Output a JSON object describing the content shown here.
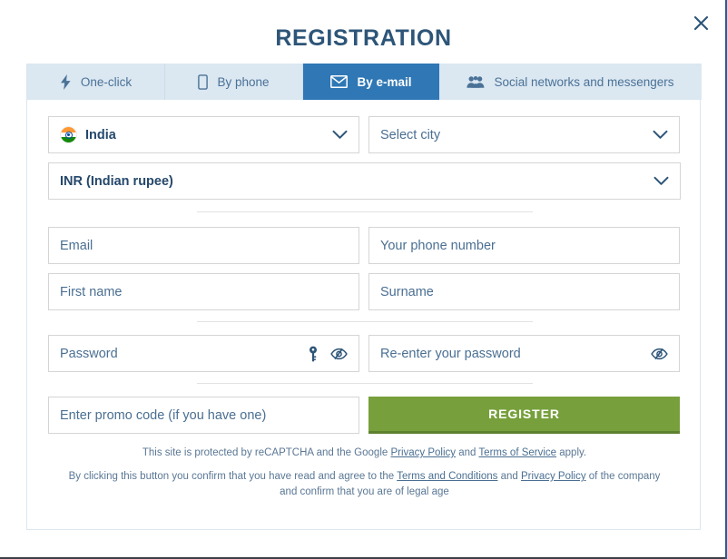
{
  "dialog": {
    "title": "REGISTRATION",
    "close_label": "×"
  },
  "tabs": [
    {
      "label": "One-click",
      "icon": "bolt-icon",
      "active": false
    },
    {
      "label": "By phone",
      "icon": "phone-icon",
      "active": false
    },
    {
      "label": "By e-mail",
      "icon": "envelope-icon",
      "active": true
    },
    {
      "label": "Social networks and messengers",
      "icon": "people-icon",
      "active": false
    }
  ],
  "form": {
    "country": {
      "value": "India",
      "icon": "india-flag-icon",
      "chevron": "chevron-down-icon"
    },
    "city": {
      "placeholder": "Select city",
      "chevron": "chevron-down-icon"
    },
    "currency": {
      "value": "INR (Indian rupee)",
      "chevron": "chevron-down-icon"
    },
    "email": {
      "placeholder": "Email",
      "value": ""
    },
    "phone": {
      "placeholder": "Your phone number",
      "value": ""
    },
    "first_name": {
      "placeholder": "First name",
      "value": ""
    },
    "surname": {
      "placeholder": "Surname",
      "value": ""
    },
    "password": {
      "placeholder": "Password",
      "value": "",
      "key_icon": "key-icon",
      "toggle_icon": "eye-slash-icon"
    },
    "confirm_password": {
      "placeholder": "Re-enter your password",
      "value": "",
      "toggle_icon": "eye-slash-icon"
    },
    "promo_code": {
      "placeholder": "Enter promo code (if you have one)",
      "value": ""
    },
    "submit_label": "REGISTER"
  },
  "legal": {
    "recaptcha": {
      "part1": "This site is protected by reCAPTCHA and the Google ",
      "link1": "Privacy Policy",
      "part2": " and ",
      "link2": "Terms of Service",
      "part3": " apply."
    },
    "terms": {
      "part1": "By clicking this button you confirm that you have read and agree to the ",
      "link1": "Terms and Conditions",
      "part2": " and ",
      "link2": "Privacy Policy",
      "part3": " of the company and confirm that you are of legal age"
    }
  },
  "colors": {
    "accent_blue": "#2f77b5",
    "title_blue": "#2d5578",
    "tab_bg": "#dbe7f1",
    "submit_green": "#77a03c",
    "submit_green_dark": "#5e8130"
  }
}
